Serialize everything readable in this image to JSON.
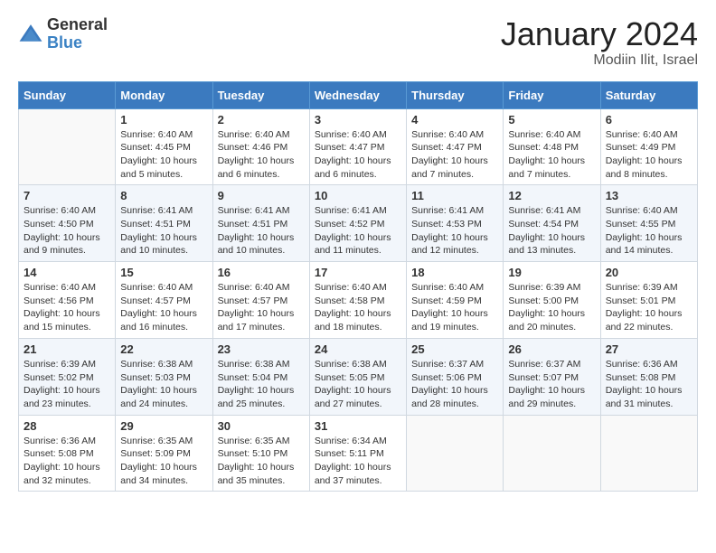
{
  "header": {
    "logo_general": "General",
    "logo_blue": "Blue",
    "main_title": "January 2024",
    "subtitle": "Modiin Ilit, Israel"
  },
  "calendar": {
    "days_of_week": [
      "Sunday",
      "Monday",
      "Tuesday",
      "Wednesday",
      "Thursday",
      "Friday",
      "Saturday"
    ],
    "weeks": [
      [
        {
          "day": "",
          "detail": ""
        },
        {
          "day": "1",
          "detail": "Sunrise: 6:40 AM\nSunset: 4:45 PM\nDaylight: 10 hours\nand 5 minutes."
        },
        {
          "day": "2",
          "detail": "Sunrise: 6:40 AM\nSunset: 4:46 PM\nDaylight: 10 hours\nand 6 minutes."
        },
        {
          "day": "3",
          "detail": "Sunrise: 6:40 AM\nSunset: 4:47 PM\nDaylight: 10 hours\nand 6 minutes."
        },
        {
          "day": "4",
          "detail": "Sunrise: 6:40 AM\nSunset: 4:47 PM\nDaylight: 10 hours\nand 7 minutes."
        },
        {
          "day": "5",
          "detail": "Sunrise: 6:40 AM\nSunset: 4:48 PM\nDaylight: 10 hours\nand 7 minutes."
        },
        {
          "day": "6",
          "detail": "Sunrise: 6:40 AM\nSunset: 4:49 PM\nDaylight: 10 hours\nand 8 minutes."
        }
      ],
      [
        {
          "day": "7",
          "detail": "Sunrise: 6:40 AM\nSunset: 4:50 PM\nDaylight: 10 hours\nand 9 minutes."
        },
        {
          "day": "8",
          "detail": "Sunrise: 6:41 AM\nSunset: 4:51 PM\nDaylight: 10 hours\nand 10 minutes."
        },
        {
          "day": "9",
          "detail": "Sunrise: 6:41 AM\nSunset: 4:51 PM\nDaylight: 10 hours\nand 10 minutes."
        },
        {
          "day": "10",
          "detail": "Sunrise: 6:41 AM\nSunset: 4:52 PM\nDaylight: 10 hours\nand 11 minutes."
        },
        {
          "day": "11",
          "detail": "Sunrise: 6:41 AM\nSunset: 4:53 PM\nDaylight: 10 hours\nand 12 minutes."
        },
        {
          "day": "12",
          "detail": "Sunrise: 6:41 AM\nSunset: 4:54 PM\nDaylight: 10 hours\nand 13 minutes."
        },
        {
          "day": "13",
          "detail": "Sunrise: 6:40 AM\nSunset: 4:55 PM\nDaylight: 10 hours\nand 14 minutes."
        }
      ],
      [
        {
          "day": "14",
          "detail": "Sunrise: 6:40 AM\nSunset: 4:56 PM\nDaylight: 10 hours\nand 15 minutes."
        },
        {
          "day": "15",
          "detail": "Sunrise: 6:40 AM\nSunset: 4:57 PM\nDaylight: 10 hours\nand 16 minutes."
        },
        {
          "day": "16",
          "detail": "Sunrise: 6:40 AM\nSunset: 4:57 PM\nDaylight: 10 hours\nand 17 minutes."
        },
        {
          "day": "17",
          "detail": "Sunrise: 6:40 AM\nSunset: 4:58 PM\nDaylight: 10 hours\nand 18 minutes."
        },
        {
          "day": "18",
          "detail": "Sunrise: 6:40 AM\nSunset: 4:59 PM\nDaylight: 10 hours\nand 19 minutes."
        },
        {
          "day": "19",
          "detail": "Sunrise: 6:39 AM\nSunset: 5:00 PM\nDaylight: 10 hours\nand 20 minutes."
        },
        {
          "day": "20",
          "detail": "Sunrise: 6:39 AM\nSunset: 5:01 PM\nDaylight: 10 hours\nand 22 minutes."
        }
      ],
      [
        {
          "day": "21",
          "detail": "Sunrise: 6:39 AM\nSunset: 5:02 PM\nDaylight: 10 hours\nand 23 minutes."
        },
        {
          "day": "22",
          "detail": "Sunrise: 6:38 AM\nSunset: 5:03 PM\nDaylight: 10 hours\nand 24 minutes."
        },
        {
          "day": "23",
          "detail": "Sunrise: 6:38 AM\nSunset: 5:04 PM\nDaylight: 10 hours\nand 25 minutes."
        },
        {
          "day": "24",
          "detail": "Sunrise: 6:38 AM\nSunset: 5:05 PM\nDaylight: 10 hours\nand 27 minutes."
        },
        {
          "day": "25",
          "detail": "Sunrise: 6:37 AM\nSunset: 5:06 PM\nDaylight: 10 hours\nand 28 minutes."
        },
        {
          "day": "26",
          "detail": "Sunrise: 6:37 AM\nSunset: 5:07 PM\nDaylight: 10 hours\nand 29 minutes."
        },
        {
          "day": "27",
          "detail": "Sunrise: 6:36 AM\nSunset: 5:08 PM\nDaylight: 10 hours\nand 31 minutes."
        }
      ],
      [
        {
          "day": "28",
          "detail": "Sunrise: 6:36 AM\nSunset: 5:08 PM\nDaylight: 10 hours\nand 32 minutes."
        },
        {
          "day": "29",
          "detail": "Sunrise: 6:35 AM\nSunset: 5:09 PM\nDaylight: 10 hours\nand 34 minutes."
        },
        {
          "day": "30",
          "detail": "Sunrise: 6:35 AM\nSunset: 5:10 PM\nDaylight: 10 hours\nand 35 minutes."
        },
        {
          "day": "31",
          "detail": "Sunrise: 6:34 AM\nSunset: 5:11 PM\nDaylight: 10 hours\nand 37 minutes."
        },
        {
          "day": "",
          "detail": ""
        },
        {
          "day": "",
          "detail": ""
        },
        {
          "day": "",
          "detail": ""
        }
      ]
    ]
  }
}
